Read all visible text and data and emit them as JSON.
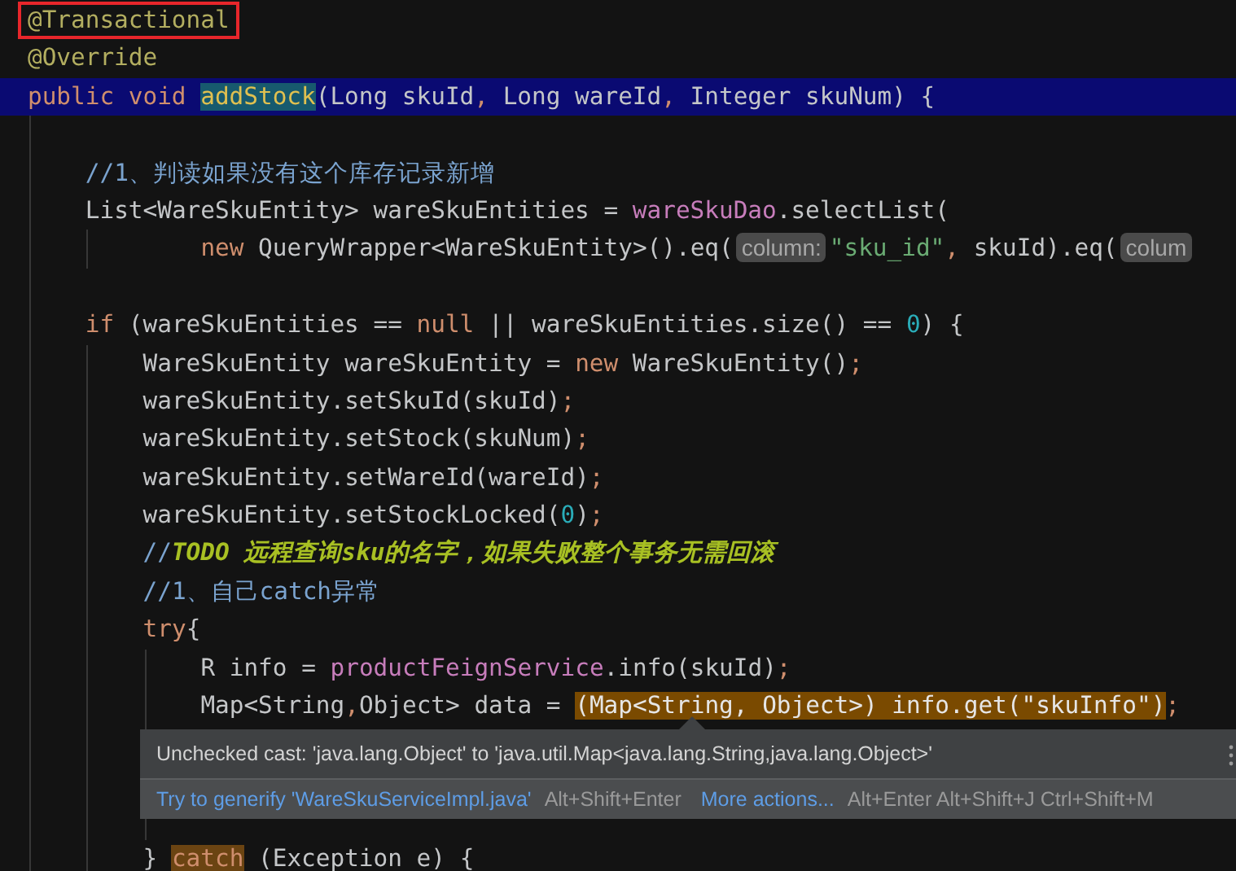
{
  "editor": {
    "lines": [
      {
        "kind": "code",
        "current": false,
        "tokens": [
          {
            "text": "@Transactional",
            "kind": "annotation",
            "outlined": true
          }
        ]
      },
      {
        "kind": "code",
        "current": false,
        "tokens": [
          {
            "text": "@Override",
            "kind": "annotation",
            "outlined": false
          }
        ]
      },
      {
        "kind": "code",
        "current": true,
        "tokens": [
          {
            "text": "public ",
            "kind": "keyword"
          },
          {
            "text": "void ",
            "kind": "keyword"
          },
          {
            "text": "addStock",
            "kind": "usage"
          },
          {
            "text": "(Long skuId",
            "kind": "plain"
          },
          {
            "text": ",",
            "kind": "punct"
          },
          {
            "text": " Long wareId",
            "kind": "plain"
          },
          {
            "text": ",",
            "kind": "punct"
          },
          {
            "text": " Integer skuNum) {",
            "kind": "plain"
          }
        ],
        "children": [
          {
            "kind": "blank"
          },
          {
            "kind": "code",
            "current": false,
            "tokens": [
              {
                "text": "//1、判读如果没有这个库存记录新增",
                "kind": "comment"
              }
            ]
          },
          {
            "kind": "code",
            "current": false,
            "tokens": [
              {
                "text": "List<WareSkuEntity> wareSkuEntities = ",
                "kind": "plain"
              },
              {
                "text": "wareSkuDao",
                "kind": "field"
              },
              {
                "text": ".selectList(",
                "kind": "plain"
              }
            ],
            "children": [
              {
                "kind": "continuation",
                "current": false,
                "tokens": [
                  {
                    "text": "new",
                    "kind": "keyword"
                  },
                  {
                    "text": " QueryWrapper<WareSkuEntity>().eq(",
                    "kind": "plain"
                  },
                  {
                    "text": "column:",
                    "kind": "hint"
                  },
                  {
                    "text": "\"sku_id\"",
                    "kind": "string"
                  },
                  {
                    "text": ",",
                    "kind": "punct"
                  },
                  {
                    "text": " skuId).eq(",
                    "kind": "plain"
                  },
                  {
                    "text": "colum",
                    "kind": "hint"
                  }
                ]
              }
            ]
          },
          {
            "kind": "blank"
          },
          {
            "kind": "code",
            "current": false,
            "tokens": [
              {
                "text": "if",
                "kind": "keyword"
              },
              {
                "text": " (wareSkuEntities == ",
                "kind": "plain"
              },
              {
                "text": "null",
                "kind": "keyword"
              },
              {
                "text": " || wareSkuEntities.size() == ",
                "kind": "plain"
              },
              {
                "text": "0",
                "kind": "number"
              },
              {
                "text": ") {",
                "kind": "plain"
              }
            ],
            "children": [
              {
                "kind": "code",
                "current": false,
                "tokens": [
                  {
                    "text": "WareSkuEntity wareSkuEntity = ",
                    "kind": "plain"
                  },
                  {
                    "text": "new",
                    "kind": "keyword"
                  },
                  {
                    "text": " WareSkuEntity()",
                    "kind": "plain"
                  },
                  {
                    "text": ";",
                    "kind": "punct"
                  }
                ]
              },
              {
                "kind": "code",
                "current": false,
                "tokens": [
                  {
                    "text": "wareSkuEntity.setSkuId(skuId)",
                    "kind": "plain"
                  },
                  {
                    "text": ";",
                    "kind": "punct"
                  }
                ]
              },
              {
                "kind": "code",
                "current": false,
                "tokens": [
                  {
                    "text": "wareSkuEntity.setStock(skuNum)",
                    "kind": "plain"
                  },
                  {
                    "text": ";",
                    "kind": "punct"
                  }
                ]
              },
              {
                "kind": "code",
                "current": false,
                "tokens": [
                  {
                    "text": "wareSkuEntity.setWareId(wareId)",
                    "kind": "plain"
                  },
                  {
                    "text": ";",
                    "kind": "punct"
                  }
                ]
              },
              {
                "kind": "code",
                "current": false,
                "tokens": [
                  {
                    "text": "wareSkuEntity.setStockLocked(",
                    "kind": "plain"
                  },
                  {
                    "text": "0",
                    "kind": "number"
                  },
                  {
                    "text": ")",
                    "kind": "plain"
                  },
                  {
                    "text": ";",
                    "kind": "punct"
                  }
                ]
              },
              {
                "kind": "code",
                "current": false,
                "tokens": [
                  {
                    "text": "//",
                    "kind": "comment"
                  },
                  {
                    "text": "TODO 远程查询sku的名字，如果失败整个事务无需回滚",
                    "kind": "todo"
                  }
                ]
              },
              {
                "kind": "code",
                "current": false,
                "tokens": [
                  {
                    "text": "//1、自己catch异常",
                    "kind": "comment"
                  }
                ]
              },
              {
                "kind": "code",
                "current": false,
                "tokens": [
                  {
                    "text": "try",
                    "kind": "keyword"
                  },
                  {
                    "text": "{",
                    "kind": "plain"
                  }
                ],
                "children": [
                  {
                    "kind": "code",
                    "current": false,
                    "tokens": [
                      {
                        "text": "R info = ",
                        "kind": "plain"
                      },
                      {
                        "text": "productFeignService",
                        "kind": "field"
                      },
                      {
                        "text": ".info(skuId)",
                        "kind": "plain"
                      },
                      {
                        "text": ";",
                        "kind": "punct"
                      }
                    ]
                  },
                  {
                    "kind": "code",
                    "current": false,
                    "tokens": [
                      {
                        "text": "Map<String",
                        "kind": "plain"
                      },
                      {
                        "text": ",",
                        "kind": "punct"
                      },
                      {
                        "text": "Object> data = ",
                        "kind": "plain"
                      },
                      {
                        "text": "(Map<String, Object>) info.get(\"skuInfo\")",
                        "kind": "warning"
                      },
                      {
                        "text": ";",
                        "kind": "punct"
                      }
                    ]
                  },
                  {
                    "kind": "blank"
                  },
                  {
                    "kind": "blank"
                  },
                  {
                    "kind": "blank"
                  }
                ]
              },
              {
                "kind": "code",
                "current": false,
                "tokens": [
                  {
                    "text": "} ",
                    "kind": "plain"
                  },
                  {
                    "text": "catch",
                    "kind": "matched-keyword"
                  },
                  {
                    "text": " (Exception e) {",
                    "kind": "plain"
                  }
                ]
              }
            ]
          }
        ]
      }
    ]
  },
  "popup": {
    "message": "Unchecked cast: 'java.lang.Object' to 'java.util.Map<java.lang.String,java.lang.Object>'",
    "actions": [
      {
        "label": "Try to generify 'WareSkuServiceImpl.java'",
        "shortcut": "Alt+Shift+Enter"
      },
      {
        "label": "More actions...",
        "shortcut": "Alt+Enter Alt+Shift+J Ctrl+Shift+M"
      }
    ]
  }
}
